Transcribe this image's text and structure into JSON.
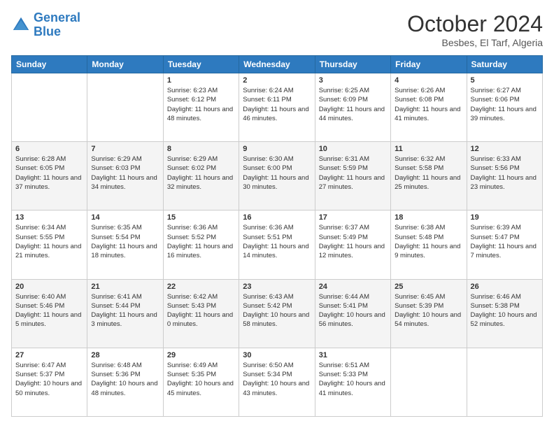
{
  "logo": {
    "line1": "General",
    "line2": "Blue"
  },
  "header": {
    "month": "October 2024",
    "location": "Besbes, El Tarf, Algeria"
  },
  "weekdays": [
    "Sunday",
    "Monday",
    "Tuesday",
    "Wednesday",
    "Thursday",
    "Friday",
    "Saturday"
  ],
  "weeks": [
    [
      {
        "day": "",
        "text": ""
      },
      {
        "day": "",
        "text": ""
      },
      {
        "day": "1",
        "text": "Sunrise: 6:23 AM\nSunset: 6:12 PM\nDaylight: 11 hours and 48 minutes."
      },
      {
        "day": "2",
        "text": "Sunrise: 6:24 AM\nSunset: 6:11 PM\nDaylight: 11 hours and 46 minutes."
      },
      {
        "day": "3",
        "text": "Sunrise: 6:25 AM\nSunset: 6:09 PM\nDaylight: 11 hours and 44 minutes."
      },
      {
        "day": "4",
        "text": "Sunrise: 6:26 AM\nSunset: 6:08 PM\nDaylight: 11 hours and 41 minutes."
      },
      {
        "day": "5",
        "text": "Sunrise: 6:27 AM\nSunset: 6:06 PM\nDaylight: 11 hours and 39 minutes."
      }
    ],
    [
      {
        "day": "6",
        "text": "Sunrise: 6:28 AM\nSunset: 6:05 PM\nDaylight: 11 hours and 37 minutes."
      },
      {
        "day": "7",
        "text": "Sunrise: 6:29 AM\nSunset: 6:03 PM\nDaylight: 11 hours and 34 minutes."
      },
      {
        "day": "8",
        "text": "Sunrise: 6:29 AM\nSunset: 6:02 PM\nDaylight: 11 hours and 32 minutes."
      },
      {
        "day": "9",
        "text": "Sunrise: 6:30 AM\nSunset: 6:00 PM\nDaylight: 11 hours and 30 minutes."
      },
      {
        "day": "10",
        "text": "Sunrise: 6:31 AM\nSunset: 5:59 PM\nDaylight: 11 hours and 27 minutes."
      },
      {
        "day": "11",
        "text": "Sunrise: 6:32 AM\nSunset: 5:58 PM\nDaylight: 11 hours and 25 minutes."
      },
      {
        "day": "12",
        "text": "Sunrise: 6:33 AM\nSunset: 5:56 PM\nDaylight: 11 hours and 23 minutes."
      }
    ],
    [
      {
        "day": "13",
        "text": "Sunrise: 6:34 AM\nSunset: 5:55 PM\nDaylight: 11 hours and 21 minutes."
      },
      {
        "day": "14",
        "text": "Sunrise: 6:35 AM\nSunset: 5:54 PM\nDaylight: 11 hours and 18 minutes."
      },
      {
        "day": "15",
        "text": "Sunrise: 6:36 AM\nSunset: 5:52 PM\nDaylight: 11 hours and 16 minutes."
      },
      {
        "day": "16",
        "text": "Sunrise: 6:36 AM\nSunset: 5:51 PM\nDaylight: 11 hours and 14 minutes."
      },
      {
        "day": "17",
        "text": "Sunrise: 6:37 AM\nSunset: 5:49 PM\nDaylight: 11 hours and 12 minutes."
      },
      {
        "day": "18",
        "text": "Sunrise: 6:38 AM\nSunset: 5:48 PM\nDaylight: 11 hours and 9 minutes."
      },
      {
        "day": "19",
        "text": "Sunrise: 6:39 AM\nSunset: 5:47 PM\nDaylight: 11 hours and 7 minutes."
      }
    ],
    [
      {
        "day": "20",
        "text": "Sunrise: 6:40 AM\nSunset: 5:46 PM\nDaylight: 11 hours and 5 minutes."
      },
      {
        "day": "21",
        "text": "Sunrise: 6:41 AM\nSunset: 5:44 PM\nDaylight: 11 hours and 3 minutes."
      },
      {
        "day": "22",
        "text": "Sunrise: 6:42 AM\nSunset: 5:43 PM\nDaylight: 11 hours and 0 minutes."
      },
      {
        "day": "23",
        "text": "Sunrise: 6:43 AM\nSunset: 5:42 PM\nDaylight: 10 hours and 58 minutes."
      },
      {
        "day": "24",
        "text": "Sunrise: 6:44 AM\nSunset: 5:41 PM\nDaylight: 10 hours and 56 minutes."
      },
      {
        "day": "25",
        "text": "Sunrise: 6:45 AM\nSunset: 5:39 PM\nDaylight: 10 hours and 54 minutes."
      },
      {
        "day": "26",
        "text": "Sunrise: 6:46 AM\nSunset: 5:38 PM\nDaylight: 10 hours and 52 minutes."
      }
    ],
    [
      {
        "day": "27",
        "text": "Sunrise: 6:47 AM\nSunset: 5:37 PM\nDaylight: 10 hours and 50 minutes."
      },
      {
        "day": "28",
        "text": "Sunrise: 6:48 AM\nSunset: 5:36 PM\nDaylight: 10 hours and 48 minutes."
      },
      {
        "day": "29",
        "text": "Sunrise: 6:49 AM\nSunset: 5:35 PM\nDaylight: 10 hours and 45 minutes."
      },
      {
        "day": "30",
        "text": "Sunrise: 6:50 AM\nSunset: 5:34 PM\nDaylight: 10 hours and 43 minutes."
      },
      {
        "day": "31",
        "text": "Sunrise: 6:51 AM\nSunset: 5:33 PM\nDaylight: 10 hours and 41 minutes."
      },
      {
        "day": "",
        "text": ""
      },
      {
        "day": "",
        "text": ""
      }
    ]
  ]
}
